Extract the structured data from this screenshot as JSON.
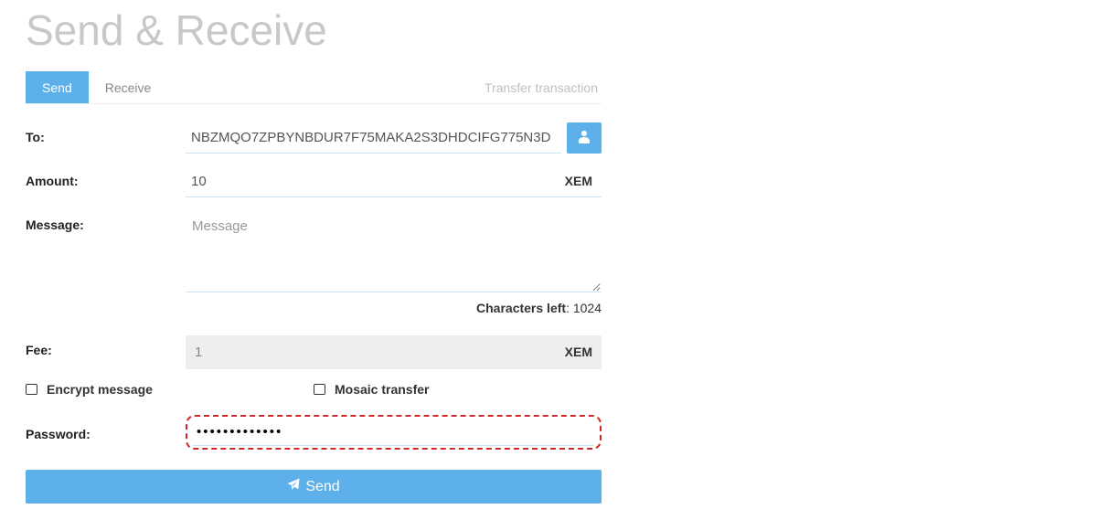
{
  "header": {
    "title": "Send & Receive"
  },
  "tabs": {
    "items": [
      {
        "label": "Send",
        "active": true
      },
      {
        "label": "Receive",
        "active": false
      }
    ],
    "hint": "Transfer transaction"
  },
  "form": {
    "to_label": "To:",
    "to_value": "NBZMQO7ZPBYNBDUR7F75MAKA2S3DHDCIFG775N3D",
    "amount_label": "Amount:",
    "amount_value": "10",
    "amount_unit": "XEM",
    "message_label": "Message:",
    "message_placeholder": "Message",
    "char_counter_label": "Characters left",
    "char_counter_value": "1024",
    "fee_label": "Fee:",
    "fee_value": "1",
    "fee_unit": "XEM",
    "encrypt_label": "Encrypt message",
    "mosaic_label": "Mosaic transfer",
    "password_label": "Password:",
    "password_value": "•••••••••••••",
    "send_button": "Send"
  }
}
